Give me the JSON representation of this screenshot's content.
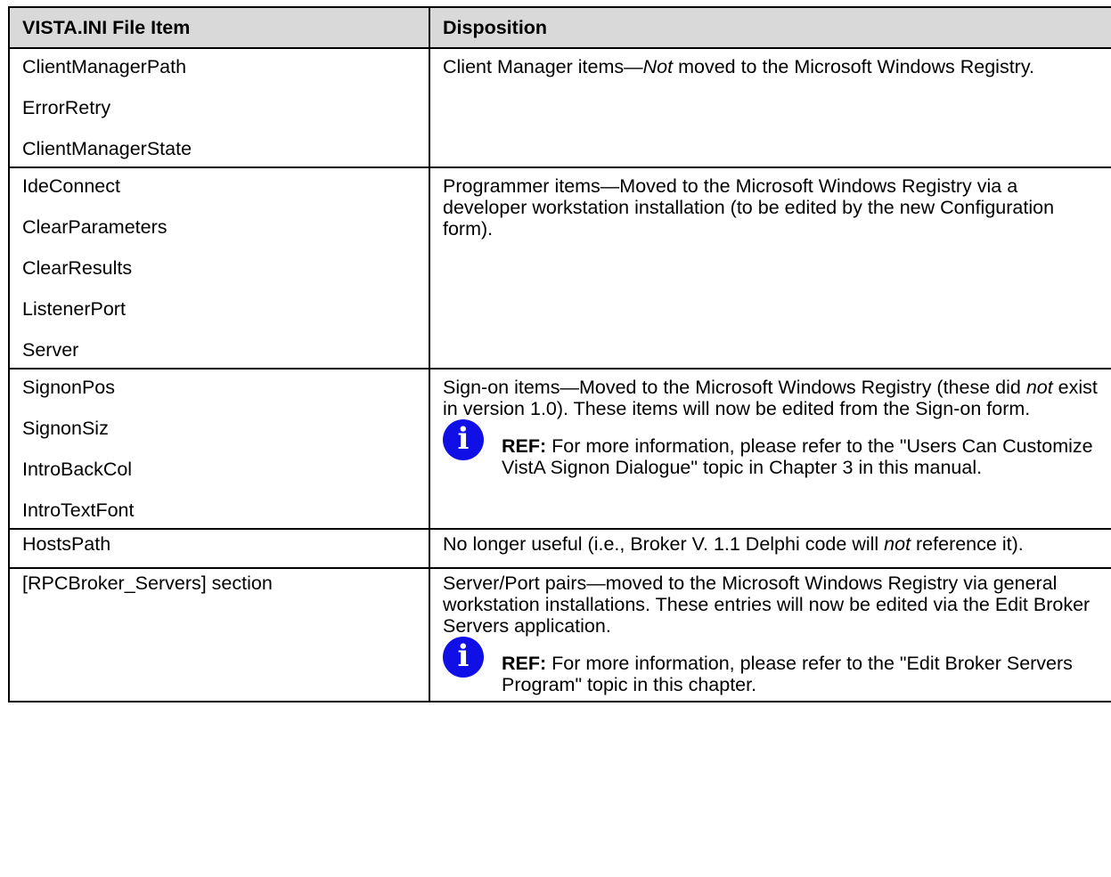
{
  "table": {
    "headers": [
      "VISTA.INI File Item",
      "Disposition"
    ],
    "rows": [
      {
        "items": [
          "ClientManagerPath",
          "ErrorRetry",
          "ClientManagerState"
        ],
        "disposition": {
          "pre": "Client Manager items—",
          "emph": "Not",
          "post": " moved to the Microsoft Windows Registry."
        }
      },
      {
        "items": [
          "IdeConnect",
          "ClearParameters",
          "ClearResults",
          "ListenerPort",
          "Server"
        ],
        "disposition": {
          "text": "Programmer items—Moved to the Microsoft Windows Registry via a developer workstation installation (to be edited by the new Configuration form)."
        }
      },
      {
        "items": [
          "SignonPos",
          "SignonSiz",
          "IntroBackCol",
          "IntroTextFont"
        ],
        "disposition": {
          "pre": "Sign-on items—Moved to the Microsoft Windows Registry (these did ",
          "emph": "not",
          "post": " exist in version 1.0). These items will now be edited from the Sign-on form.",
          "ref": {
            "label": "REF:",
            "text": " For more information, please refer to the \"Users Can Customize VistA Signon Dialogue\" topic in Chapter 3 in this manual."
          }
        }
      },
      {
        "items": [
          "HostsPath"
        ],
        "disposition": {
          "pre": "No longer useful (i.e., Broker V. 1.1 Delphi code will ",
          "emph": "not",
          "post": " reference it)."
        }
      },
      {
        "items": [
          "[RPCBroker_Servers] section"
        ],
        "disposition": {
          "text": "Server/Port pairs—moved to the Microsoft Windows Registry via general workstation installations. These entries will now be edited via the Edit Broker Servers application.",
          "ref": {
            "label": "REF:",
            "text": " For more information, please refer to the \"Edit Broker Servers Program\" topic in this chapter."
          }
        }
      }
    ]
  },
  "icons": {
    "info": "i",
    "info_color": "#1010e6"
  }
}
